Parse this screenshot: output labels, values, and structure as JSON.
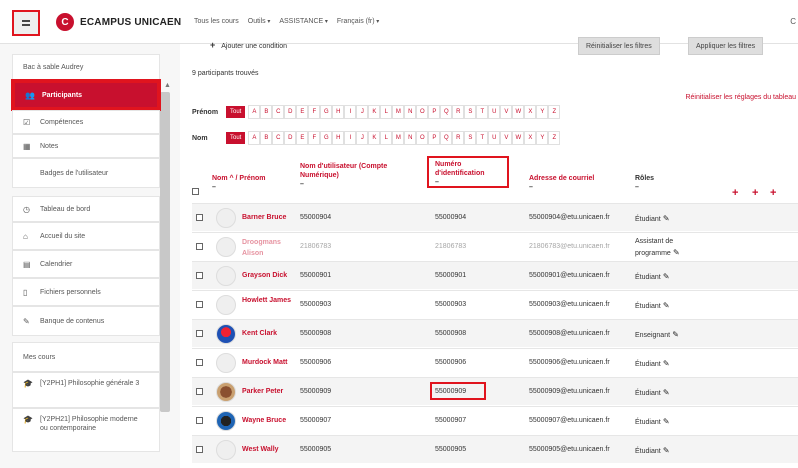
{
  "header": {
    "logo_letter": "C",
    "brand": "ECAMPUS UNICAEN",
    "nav": [
      "Tous les cours",
      "Outils",
      "ASSISTANCE",
      "Français (fr)"
    ],
    "right_char": "C"
  },
  "sidebar": {
    "course_label": "Bac à sable Audrey",
    "items": [
      {
        "label": "Participants",
        "icon": "users-icon"
      },
      {
        "label": "Compétences",
        "icon": "competencies-icon"
      },
      {
        "label": "Notes",
        "icon": "grades-icon"
      },
      {
        "label": "Badges de l'utilisateur",
        "icon": ""
      },
      {
        "label": "Tableau de bord",
        "icon": "dashboard-icon"
      },
      {
        "label": "Accueil du site",
        "icon": "home-icon"
      },
      {
        "label": "Calendrier",
        "icon": "calendar-icon"
      },
      {
        "label": "Fichiers personnels",
        "icon": "file-icon"
      },
      {
        "label": "Banque de contenus",
        "icon": "pencil-icon"
      }
    ],
    "my_courses_label": "Mes cours",
    "courses": [
      "[Y2PH1] Philosophie générale 3",
      "[Y2PH21] Philosophie moderne ou contemporaine"
    ]
  },
  "main": {
    "add_condition": "Ajouter une condition",
    "reset_filters": "Réinitialiser les filtres",
    "apply_filters": "Appliquer les filtres",
    "participants_found": "9 participants trouvés",
    "reset_table": "Réinitialiser les réglages du tableau",
    "firstname_label": "Prénom",
    "lastname_label": "Nom",
    "all_label": "Tout",
    "letters": [
      "A",
      "B",
      "C",
      "D",
      "E",
      "F",
      "G",
      "H",
      "I",
      "J",
      "K",
      "L",
      "M",
      "N",
      "O",
      "P",
      "Q",
      "R",
      "S",
      "T",
      "U",
      "V",
      "W",
      "X",
      "Y",
      "Z"
    ],
    "columns": {
      "name": "Nom ^ / Prénom",
      "username": "Nom d'utilisateur (Compte Numérique)",
      "id_number": "Numéro d'identification",
      "email": "Adresse de courriel",
      "roles": "Rôles",
      "dash": "–"
    },
    "rows": [
      {
        "name": "Barner Bruce",
        "username": "55000904",
        "id": "55000904",
        "email": "55000904@etu.unicaen.fr",
        "role": "Étudiant"
      },
      {
        "name": "Droogmans Alison",
        "username": "21806783",
        "id": "21806783",
        "email": "21806783@etu.unicaen.fr",
        "role": "Assistant de programme"
      },
      {
        "name": "Grayson Dick",
        "username": "55000901",
        "id": "55000901",
        "email": "55000901@etu.unicaen.fr",
        "role": "Étudiant"
      },
      {
        "name": "Howlett James",
        "username": "55000903",
        "id": "55000903",
        "email": "55000903@etu.unicaen.fr",
        "role": "Étudiant"
      },
      {
        "name": "Kent Clark",
        "username": "55000908",
        "id": "55000908",
        "email": "55000908@etu.unicaen.fr",
        "role": "Enseignant"
      },
      {
        "name": "Murdock Matt",
        "username": "55000906",
        "id": "55000906",
        "email": "55000906@etu.unicaen.fr",
        "role": "Étudiant"
      },
      {
        "name": "Parker Peter",
        "username": "55000909",
        "id": "55000909",
        "email": "55000909@etu.unicaen.fr",
        "role": "Étudiant"
      },
      {
        "name": "Wayne Bruce",
        "username": "55000907",
        "id": "55000907",
        "email": "55000907@etu.unicaen.fr",
        "role": "Étudiant"
      },
      {
        "name": "West Wally",
        "username": "55000905",
        "id": "55000905",
        "email": "55000905@etu.unicaen.fr",
        "role": "Étudiant"
      }
    ]
  },
  "colors": {
    "accent": "#c8102e",
    "highlight": "#e0141e"
  }
}
